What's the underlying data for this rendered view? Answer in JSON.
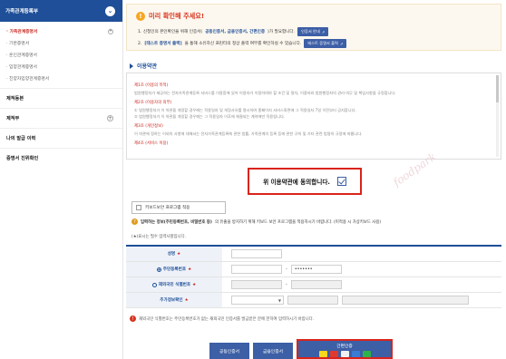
{
  "sidebar": {
    "header": "가족관계등록부",
    "sub_items": [
      {
        "label": "· 가족관계증명서",
        "active": true
      },
      {
        "label": "· 기본증명서",
        "active": false
      },
      {
        "label": "· 혼인관계증명서",
        "active": false
      },
      {
        "label": "· 입양관계증명서",
        "active": false
      },
      {
        "label": "· 친양자입양관계증명서",
        "active": false
      }
    ],
    "main_items": [
      {
        "label": "제적등본",
        "has_plus": false
      },
      {
        "label": "제적부",
        "has_plus": true
      },
      {
        "label": "나의 발급 이력",
        "has_plus": false
      },
      {
        "label": "증명서 진위확인",
        "has_plus": false
      }
    ]
  },
  "notice": {
    "title": "미리 확인해 주세요!",
    "line1_pre": "1. 신청인의 본인확인을 위해 인증서(",
    "line1_hl": "공동인증서, 금융인증서, 간편인증",
    "line1_post": ")가 필요합니다.",
    "line1_btn": "인증서 안내",
    "line2_pre": "2. ",
    "line2_hl": "[테스트 증명서 출력]",
    "line2_post": "을 통해 소유하신 프린터의 정상 출력 여부를 확인하실 수 있습니다.",
    "line2_btn": "테스트 증명서 출력"
  },
  "terms": {
    "section_title": "이용약관",
    "paragraphs": [
      {
        "heading": "제1조 (이용의 목적)",
        "body": "법원행정처가 제공하는 전자가족관계등록 서비스를 이용함에 있어 이용자가 이용하여야 할 조건 및 절차, 이용자와 법원행정처의 권리·의무 및 책임사항을 규정합니다."
      },
      {
        "heading": "제2조 (이용자의 의무)",
        "body": "① 법원행정처가 이 약관을 개정할 경우에는 적용일자 및 개정사유를 명시하여 홈페이지 서비스화면에 그 적용일자 7일 이전부터 공지합니다.\n② 법원행정처가 이 약관을 개정할 경우에는 그 적용일자 이후에 체결되는 계약에만 적용됩니다."
      },
      {
        "heading": "제3조 (개인정보)",
        "body": "이 약관에 정하는 이외의 사항에 대해서는 전자가족관계등록에 관한 법률, 가족관계의 등록 등에 관한 규칙 및 기타 관련 법령의 규정에 따릅니다."
      },
      {
        "heading": "제4조 (서비스 이용)",
        "body": ""
      }
    ]
  },
  "agree": {
    "label": "위 이용약관에 동의합니다.",
    "checked": true
  },
  "keyboard_security": {
    "label": "키보드보안 프로그램 적용"
  },
  "warn": {
    "bold": "입력하는 정보(주민등록번호, 비밀번호 등)",
    "rest": "의 유출을 방지하기 위해 키보드 보안 프로그램을 적용하시기 바랍니다. (미적용 시 가상키보드 사용)"
  },
  "required_note": "(★)표시는 필수 입력사항입니다.",
  "form": {
    "rows": [
      {
        "label": "성명",
        "required": true,
        "radio": null,
        "fields": [
          {
            "value": "",
            "width": 56
          }
        ]
      },
      {
        "label": "주민등록번호",
        "required": true,
        "radio": "on",
        "fields": [
          {
            "value": "",
            "width": 56
          },
          {
            "value": "•••••••",
            "width": 56
          }
        ]
      },
      {
        "label": "재외국민 식별번호",
        "required": true,
        "radio": "off",
        "fields": [
          {
            "value": "",
            "width": 56,
            "disabled": true
          },
          {
            "value": "",
            "width": 56,
            "disabled": true
          }
        ]
      },
      {
        "label": "추가정보확인",
        "required": true,
        "radio": null,
        "fields": []
      }
    ],
    "extra_select_arrow": "▼"
  },
  "bottom_note": "재외국민 식별번호는 주민등록번호가 없는 재외국민 인증서를 발급받은 분에 한하여 입력하시기 바랍니다.",
  "cert_buttons": {
    "joint": "공동인증서",
    "finance": "금융인증서",
    "simple": "간편인증"
  },
  "simple_icons": [
    {
      "name": "kakao-icon",
      "color": "#f7d81d"
    },
    {
      "name": "pass-icon",
      "color": "#e03a2f"
    },
    {
      "name": "naver-icon",
      "color": "#f0f0f0"
    },
    {
      "name": "toss-icon",
      "color": "#3a7bd5"
    },
    {
      "name": "payco-icon",
      "color": "#2cb34a"
    }
  ],
  "watermark": "foodpark"
}
